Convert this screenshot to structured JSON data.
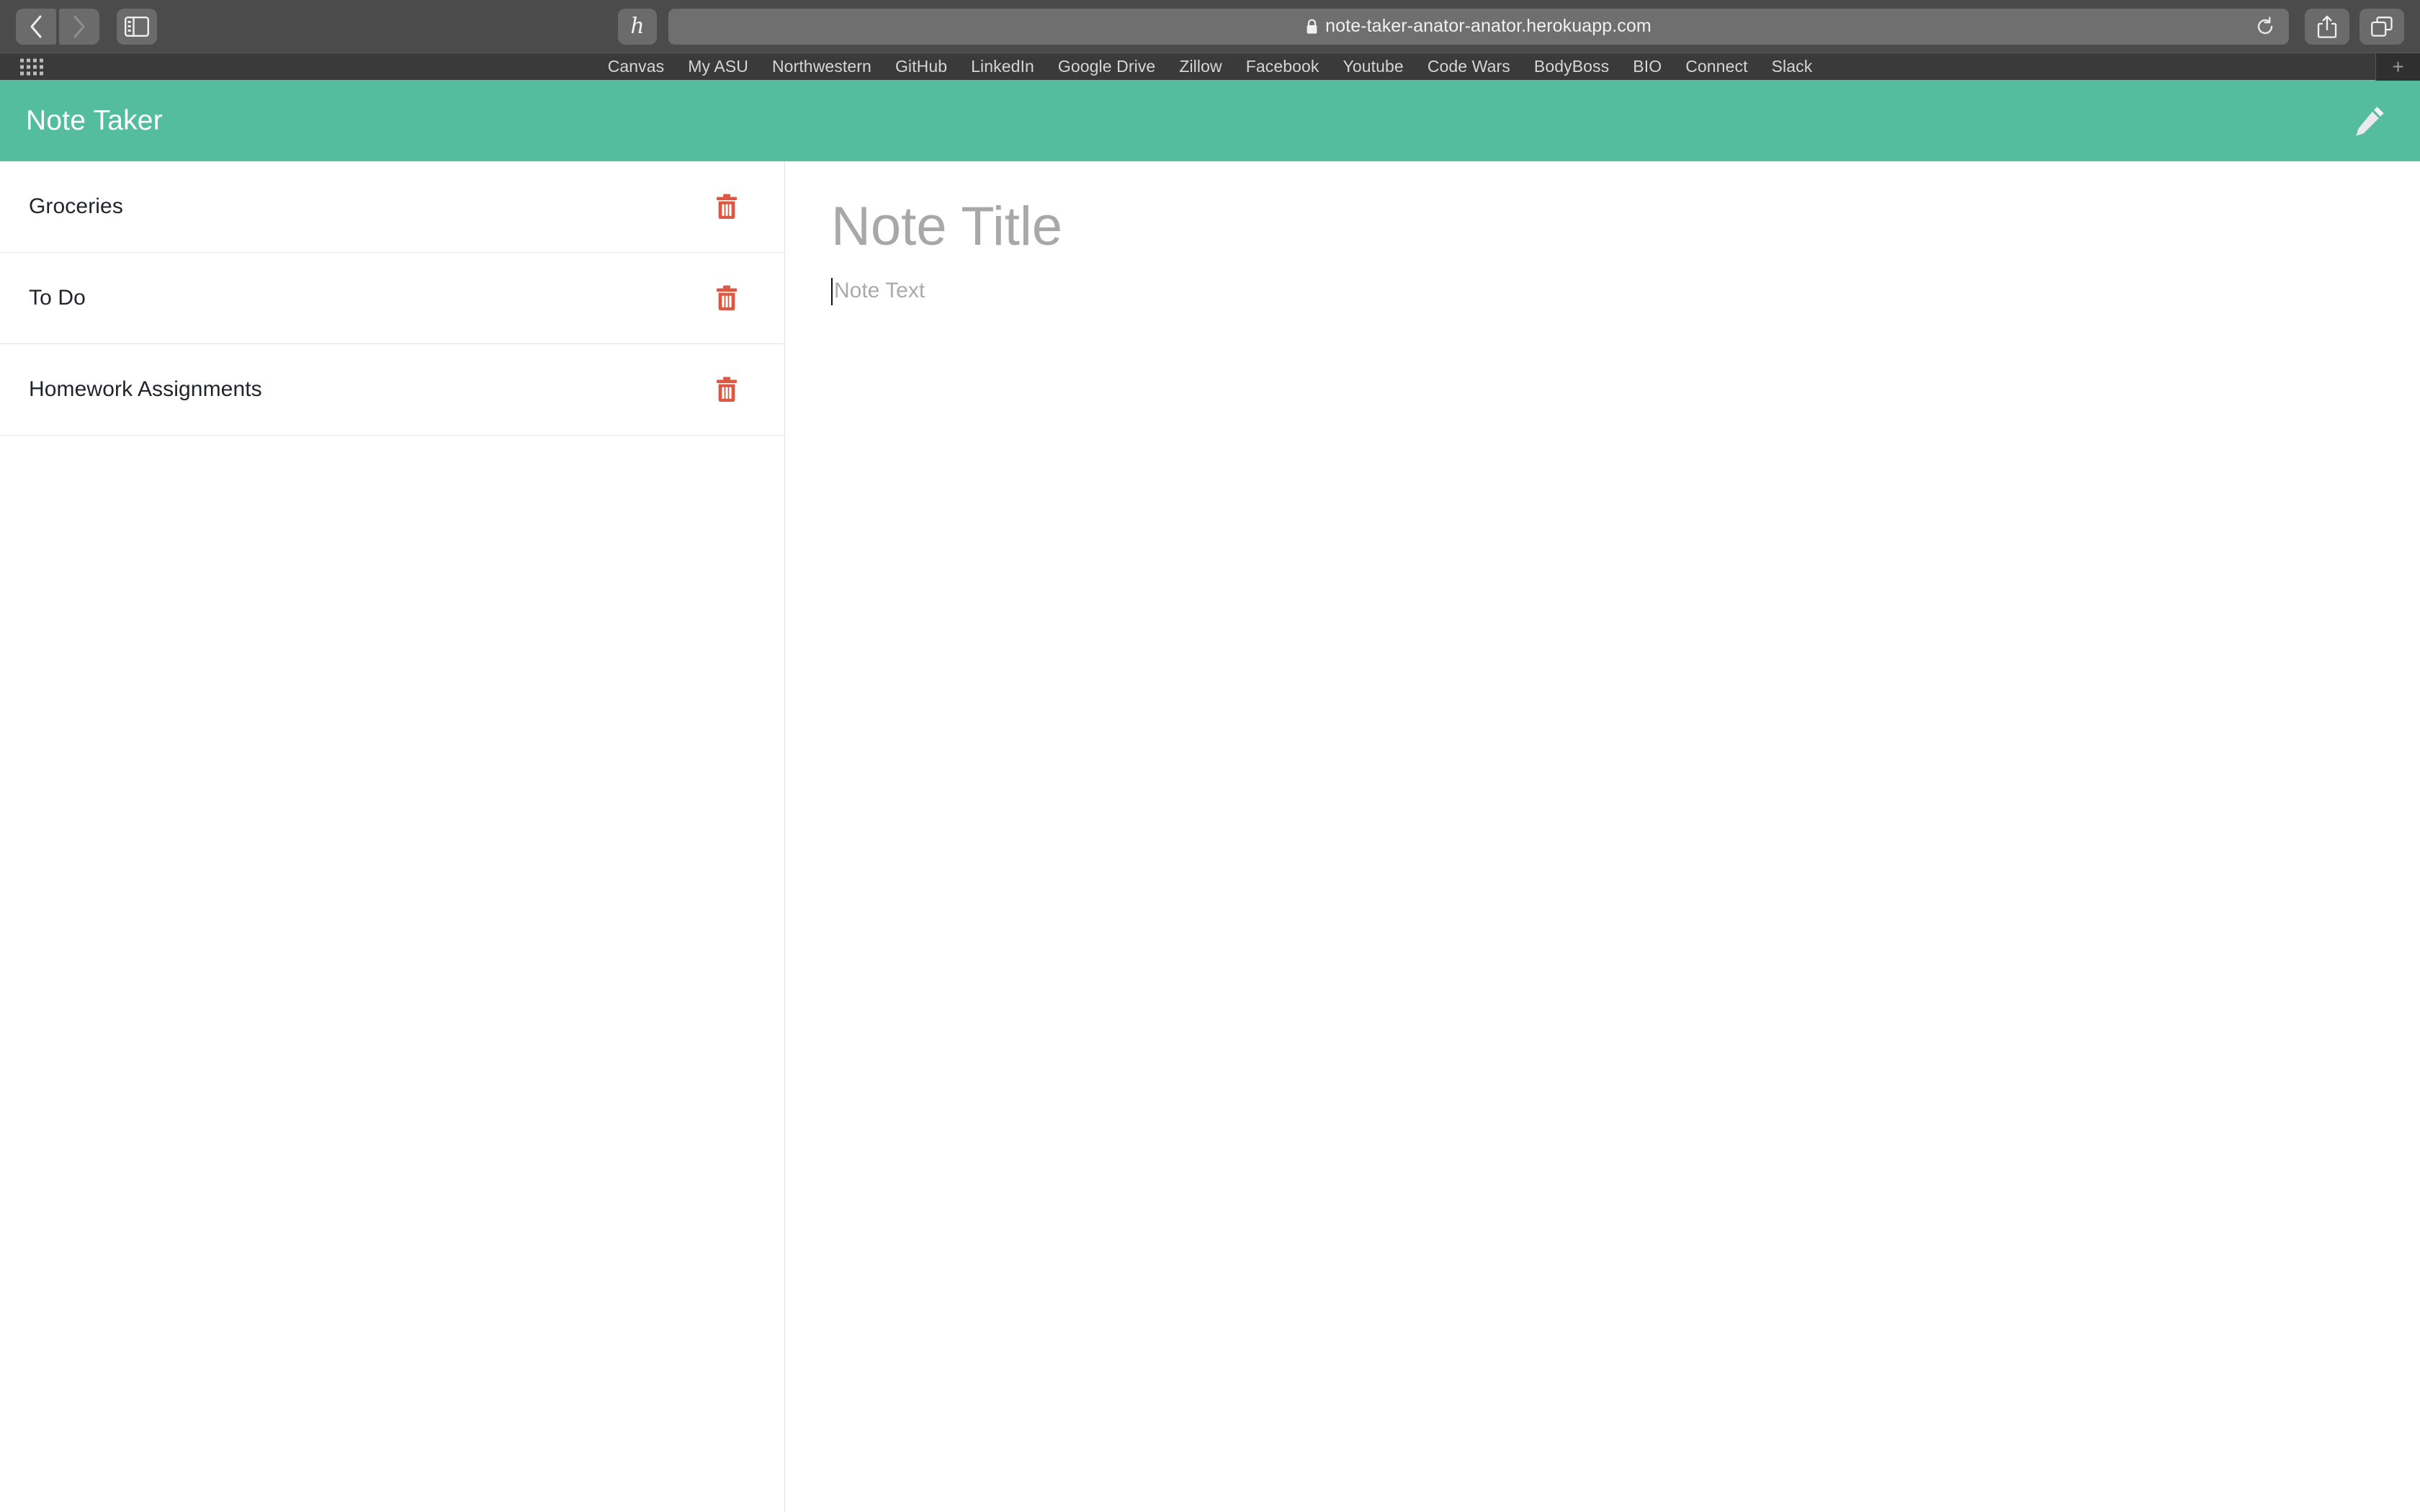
{
  "browser": {
    "back_label": "Back",
    "forward_label": "Forward",
    "sidebar_label": "Show Sidebar",
    "extension_glyph": "h",
    "url": "note-taker-anator-anator.herokuapp.com",
    "reload_label": "Reload",
    "share_label": "Share",
    "tabs_label": "Show Tab Overview",
    "newtab_label": "+"
  },
  "bookmarks": {
    "apps_label": "Apps",
    "items": [
      {
        "label": "Canvas"
      },
      {
        "label": "My ASU"
      },
      {
        "label": "Northwestern"
      },
      {
        "label": "GitHub"
      },
      {
        "label": "LinkedIn"
      },
      {
        "label": "Google Drive"
      },
      {
        "label": "Zillow"
      },
      {
        "label": "Facebook"
      },
      {
        "label": "Youtube"
      },
      {
        "label": "Code Wars"
      },
      {
        "label": "BodyBoss"
      },
      {
        "label": "BIO"
      },
      {
        "label": "Connect"
      },
      {
        "label": "Slack"
      }
    ]
  },
  "app": {
    "title": "Note Taker",
    "header_color": "#54bd9e",
    "new_note_label": "New Note",
    "notes": [
      {
        "title": "Groceries",
        "delete_label": "Delete note"
      },
      {
        "title": "To Do",
        "delete_label": "Delete note"
      },
      {
        "title": "Homework Assignments",
        "delete_label": "Delete note"
      }
    ],
    "editor": {
      "title_value": "",
      "title_placeholder": "Note Title",
      "text_value": "",
      "text_placeholder": "Note Text"
    },
    "accent_colors": {
      "header": "#54bd9e",
      "delete": "#dc5843"
    }
  }
}
